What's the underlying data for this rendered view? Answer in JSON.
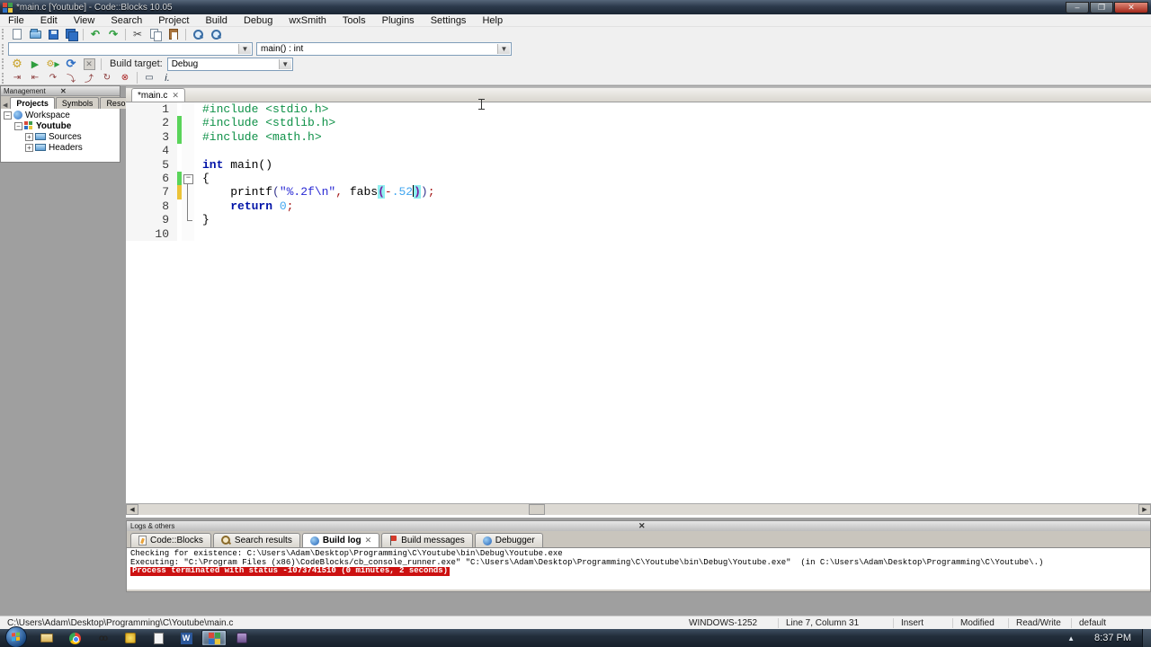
{
  "window": {
    "title": "*main.c [Youtube] - Code::Blocks 10.05",
    "minimize": "–",
    "restore": "❐",
    "close": "✕"
  },
  "menu": {
    "items": [
      "File",
      "Edit",
      "View",
      "Search",
      "Project",
      "Build",
      "Debug",
      "wxSmith",
      "Tools",
      "Plugins",
      "Settings",
      "Help"
    ]
  },
  "toolbars": {
    "scope_combo_value": "",
    "function_combo_value": "main() : int",
    "build_target_label": "Build target:",
    "build_target_value": "Debug",
    "debug_info_glyph": "i."
  },
  "management": {
    "title": "Management",
    "close_glyph": "✕",
    "tabs": [
      {
        "label": "Projects"
      },
      {
        "label": "Symbols"
      },
      {
        "label": "Resou"
      }
    ],
    "tree": [
      {
        "level": 0,
        "icon": "workspace",
        "label": "Workspace",
        "expand": "−",
        "bold": false
      },
      {
        "level": 1,
        "icon": "project",
        "label": "Youtube",
        "expand": "−",
        "bold": true
      },
      {
        "level": 2,
        "icon": "folder",
        "label": "Sources",
        "expand": "+",
        "bold": false
      },
      {
        "level": 2,
        "icon": "folder",
        "label": "Headers",
        "expand": "+",
        "bold": false
      }
    ]
  },
  "editor": {
    "tab_label": "*main.c",
    "tab_close_glyph": "✕",
    "lines": [
      {
        "num": "1",
        "marker": "none",
        "fold": "none",
        "segments": [
          {
            "c": "pre",
            "t": "#include <stdio.h>"
          }
        ]
      },
      {
        "num": "2",
        "marker": "green",
        "fold": "none",
        "segments": [
          {
            "c": "pre",
            "t": "#include <stdlib.h>"
          }
        ]
      },
      {
        "num": "3",
        "marker": "green",
        "fold": "none",
        "segments": [
          {
            "c": "pre",
            "t": "#include <math.h>"
          }
        ]
      },
      {
        "num": "4",
        "marker": "none",
        "fold": "none",
        "segments": []
      },
      {
        "num": "5",
        "marker": "none",
        "fold": "none",
        "segments": [
          {
            "c": "kw",
            "t": "int"
          },
          {
            "c": "txt",
            "t": " main()"
          }
        ]
      },
      {
        "num": "6",
        "marker": "green",
        "fold": "minus",
        "segments": [
          {
            "c": "txt",
            "t": "{"
          }
        ]
      },
      {
        "num": "7",
        "marker": "yellow",
        "fold": "line",
        "segments": [
          {
            "c": "txt",
            "t": "    printf"
          },
          {
            "c": "par",
            "t": "("
          },
          {
            "c": "str",
            "t": "\"%.2f\\n\""
          },
          {
            "c": "op",
            "t": ","
          },
          {
            "c": "txt",
            "t": " fabs"
          },
          {
            "c": "match",
            "t": "("
          },
          {
            "c": "op",
            "t": "-"
          },
          {
            "c": "num",
            "t": ".52"
          },
          {
            "c": "caret",
            "t": ""
          },
          {
            "c": "match",
            "t": ")"
          },
          {
            "c": "par",
            "t": ")"
          },
          {
            "c": "op",
            "t": ";"
          }
        ]
      },
      {
        "num": "8",
        "marker": "none",
        "fold": "line",
        "segments": [
          {
            "c": "txt",
            "t": "    "
          },
          {
            "c": "kw",
            "t": "return"
          },
          {
            "c": "txt",
            "t": " "
          },
          {
            "c": "num",
            "t": "0"
          },
          {
            "c": "op",
            "t": ";"
          }
        ]
      },
      {
        "num": "9",
        "marker": "none",
        "fold": "end",
        "segments": [
          {
            "c": "txt",
            "t": "}"
          }
        ]
      },
      {
        "num": "10",
        "marker": "none",
        "fold": "none",
        "segments": []
      }
    ]
  },
  "logs": {
    "title": "Logs & others",
    "close_glyph": "✕",
    "tabs": [
      {
        "label": "Code::Blocks",
        "icon": "codeblocks-log-icon",
        "selected": false,
        "closable": false
      },
      {
        "label": "Search results",
        "icon": "search-icon",
        "selected": false,
        "closable": false
      },
      {
        "label": "Build log",
        "icon": "gear-icon",
        "selected": true,
        "closable": true
      },
      {
        "label": "Build messages",
        "icon": "flag-icon",
        "selected": false,
        "closable": false
      },
      {
        "label": "Debugger",
        "icon": "debugger-icon",
        "selected": false,
        "closable": false
      }
    ],
    "lines": [
      {
        "style": "normal",
        "text": "Checking for existence: C:\\Users\\Adam\\Desktop\\Programming\\C\\Youtube\\bin\\Debug\\Youtube.exe"
      },
      {
        "style": "normal",
        "text": "Executing: \"C:\\Program Files (x86)\\CodeBlocks/cb_console_runner.exe\" \"C:\\Users\\Adam\\Desktop\\Programming\\C\\Youtube\\bin\\Debug\\Youtube.exe\"  (in C:\\Users\\Adam\\Desktop\\Programming\\C\\Youtube\\.)"
      },
      {
        "style": "error",
        "text": "Process terminated with status -1073741510 (0 minutes, 2 seconds)"
      }
    ]
  },
  "statusbar": {
    "path": "C:\\Users\\Adam\\Desktop\\Programming\\C\\Youtube\\main.c",
    "encoding": "WINDOWS-1252",
    "position": "Line 7, Column 31",
    "insert_mode": "Insert",
    "modified": "Modified",
    "readwrite": "Read/Write",
    "profile": "default"
  },
  "taskbar": {
    "icons": [
      "start",
      "explorer",
      "chrome",
      "recorder",
      "messenger",
      "notepad",
      "word",
      "codeblocks",
      "misc"
    ],
    "tray_arrow": "▲",
    "clock": "8:37 PM"
  },
  "colors": {
    "accent_green_marker": "#5ad45a",
    "accent_yellow_marker": "#ecc338",
    "log_error_bg": "#cc1111",
    "keyword": "#0013a7",
    "preprocessor": "#0f9148",
    "string": "#2a2ad4",
    "number": "#41a6f0",
    "brace_match_bg": "#8ff0f0"
  }
}
